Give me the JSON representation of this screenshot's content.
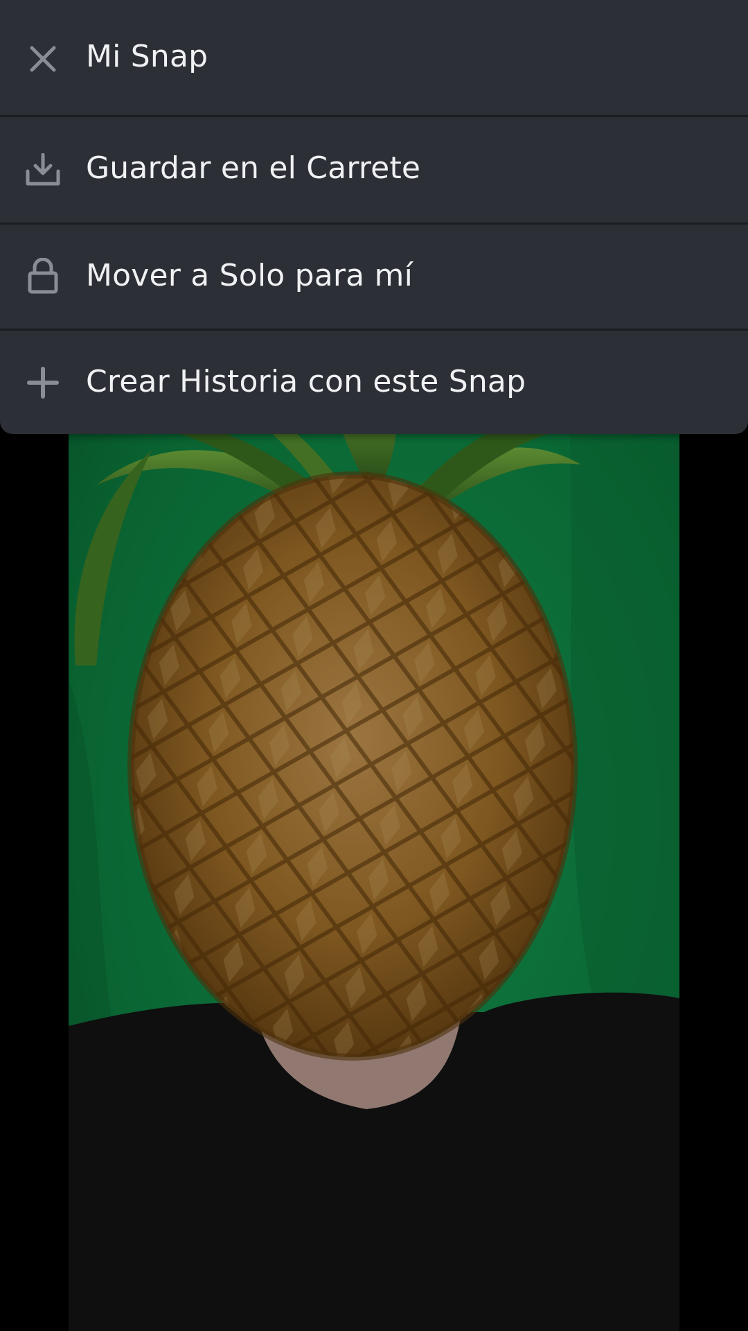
{
  "menu": {
    "items": [
      {
        "label": "Mi Snap",
        "icon": "close-icon"
      },
      {
        "label": "Guardar en el Carrete",
        "icon": "download-icon"
      },
      {
        "label": "Mover a Solo para mí",
        "icon": "lock-icon"
      },
      {
        "label": "Crear Historia con este Snap",
        "icon": "plus-icon"
      }
    ]
  },
  "photo": {
    "description_icon": "snap-photo",
    "colors": {
      "background": "#0f8c45",
      "pineapple": "#b07a2e",
      "leaves": "#4a8a2a",
      "shirt": "#151515"
    }
  },
  "colors": {
    "menu_background": "#2c2f36",
    "menu_text": "#f0f1f3",
    "icon": "#8a8d94",
    "divider": "#1b1d22"
  }
}
